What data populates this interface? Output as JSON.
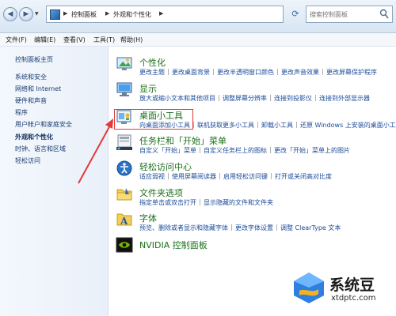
{
  "address": {
    "crumbs": [
      "控制面板",
      "外观和个性化"
    ],
    "search_placeholder": "搜索控制面板"
  },
  "menu": [
    "文件(F)",
    "编辑(E)",
    "查看(V)",
    "工具(T)",
    "帮助(H)"
  ],
  "sidebar": {
    "home": "控制面板主页",
    "items": [
      "系统和安全",
      "网络和 Internet",
      "硬件和声音",
      "程序",
      "用户帐户和家庭安全",
      "外观和个性化",
      "时钟、语言和区域",
      "轻松访问"
    ],
    "current": "外观和个性化"
  },
  "categories": [
    {
      "title": "个性化",
      "links": [
        "更改主题",
        "更改桌面背景",
        "更改半透明窗口颜色",
        "更改声音效果",
        "更改屏幕保护程序"
      ]
    },
    {
      "title": "显示",
      "links": [
        "放大或缩小文本和其他项目",
        "调整屏幕分辨率",
        "连接到投影仪",
        "连接到外部显示器"
      ]
    },
    {
      "title": "桌面小工具",
      "links": [
        "向桌面添加小工具",
        "联机获取更多小工具",
        "卸载小工具",
        "还原 Windows 上安装的桌面小工具"
      ]
    },
    {
      "title": "任务栏和「开始」菜单",
      "links": [
        "自定义「开始」菜单",
        "自定义任务栏上的图标",
        "更改「开始」菜单上的图片"
      ]
    },
    {
      "title": "轻松访问中心",
      "links": [
        "适应弱视",
        "使用屏幕阅读器",
        "启用轻松访问键",
        "打开或关闭高对比度"
      ]
    },
    {
      "title": "文件夹选项",
      "links": [
        "指定单击或双击打开",
        "显示隐藏的文件和文件夹"
      ]
    },
    {
      "title": "字体",
      "links": [
        "预览、删除或者显示和隐藏字体",
        "更改字体设置",
        "调整 ClearType 文本"
      ]
    },
    {
      "title": "NVIDIA 控制面板",
      "links": []
    }
  ],
  "watermark": {
    "brand": "系统豆",
    "url": "xtdptc.com"
  },
  "colors": {
    "category_title": "#1a6f1a",
    "link": "#1a4a9a",
    "highlight": "#e23a3a"
  }
}
